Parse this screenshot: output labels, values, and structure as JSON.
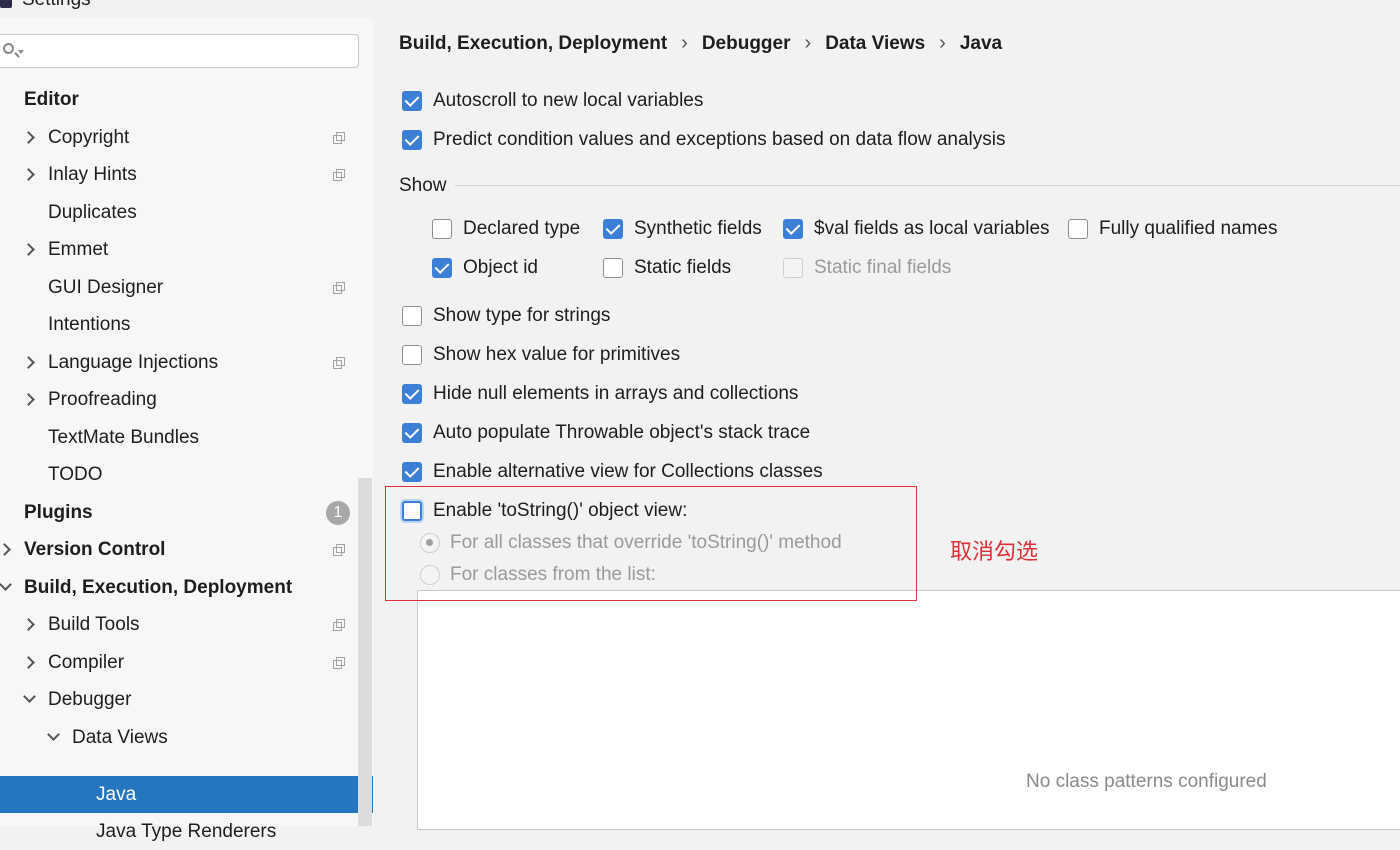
{
  "window": {
    "title": "Settings"
  },
  "search": {
    "placeholder": "",
    "value": ""
  },
  "sidebar": {
    "items": [
      {
        "label": "Editor",
        "bold": true
      },
      {
        "label": "Copyright"
      },
      {
        "label": "Inlay Hints"
      },
      {
        "label": "Duplicates"
      },
      {
        "label": "Emmet"
      },
      {
        "label": "GUI Designer"
      },
      {
        "label": "Intentions"
      },
      {
        "label": "Language Injections"
      },
      {
        "label": "Proofreading"
      },
      {
        "label": "TextMate Bundles"
      },
      {
        "label": "TODO"
      },
      {
        "label": "Plugins",
        "bold": true,
        "badge": "1"
      },
      {
        "label": "Version Control",
        "bold": true
      },
      {
        "label": "Build, Execution, Deployment",
        "bold": true
      },
      {
        "label": "Build Tools"
      },
      {
        "label": "Compiler"
      },
      {
        "label": "Debugger"
      },
      {
        "label": "Data Views"
      },
      {
        "label": "Java",
        "selected": true
      },
      {
        "label": "Java Type Renderers"
      }
    ]
  },
  "breadcrumb": [
    "Build, Execution, Deployment",
    "Debugger",
    "Data Views",
    "Java"
  ],
  "options": {
    "autoscroll": {
      "label": "Autoscroll to new local variables",
      "checked": true
    },
    "predict": {
      "label": "Predict condition values and exceptions based on data flow analysis",
      "checked": true
    },
    "show_title": "Show",
    "declared_type": {
      "label": "Declared type",
      "checked": false
    },
    "synthetic_fields": {
      "label": "Synthetic fields",
      "checked": true
    },
    "val_fields": {
      "label": "$val fields as local variables",
      "checked": true
    },
    "fully_qualified": {
      "label": "Fully qualified names",
      "checked": false
    },
    "object_id": {
      "label": "Object id",
      "checked": true
    },
    "static_fields": {
      "label": "Static fields",
      "checked": false
    },
    "static_final_fields": {
      "label": "Static final fields",
      "checked": false,
      "disabled": true
    },
    "type_strings": {
      "label": "Show type for strings",
      "checked": false
    },
    "hex_primitives": {
      "label": "Show hex value for primitives",
      "checked": false
    },
    "hide_null": {
      "label": "Hide null elements in arrays and collections",
      "checked": true
    },
    "auto_populate": {
      "label": "Auto populate Throwable object's stack trace",
      "checked": true
    },
    "alt_view": {
      "label": "Enable alternative view for Collections classes",
      "checked": true
    },
    "tostring_view": {
      "label": "Enable 'toString()' object view:",
      "checked": false
    },
    "radio_all": {
      "label": "For all classes that override 'toString()' method",
      "selected": true,
      "disabled": true
    },
    "radio_list": {
      "label": "For classes from the list:",
      "selected": false,
      "disabled": true
    }
  },
  "class_list": {
    "empty_text": "No class patterns configured"
  },
  "annotation": {
    "text": "取消勾选",
    "color": "#e0303a"
  },
  "colors": {
    "accent": "#3c7fd6",
    "selection": "#2675bf"
  }
}
